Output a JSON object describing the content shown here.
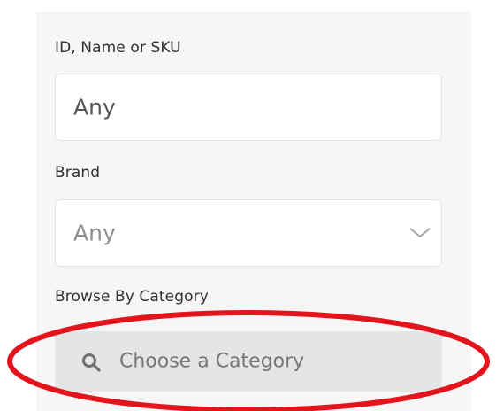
{
  "filters": {
    "id_label": "ID, Name or SKU",
    "id_value": "Any",
    "brand_label": "Brand",
    "brand_value": "Any",
    "category_label": "Browse By Category",
    "category_button": "Choose a Category"
  },
  "icons": {
    "brand_dropdown": "chevron-down-icon",
    "category_search": "search-icon"
  },
  "colors": {
    "panel_bg": "#f6f6f6",
    "field_bg": "#ffffff",
    "button_bg": "#e4e5e7",
    "annotation": "#e3141b"
  }
}
